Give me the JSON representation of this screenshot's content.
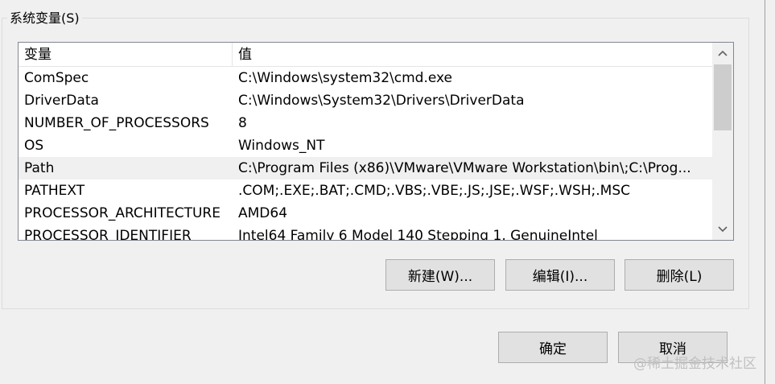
{
  "group": {
    "label": "系统变量(S)"
  },
  "list": {
    "headers": [
      "变量",
      "值"
    ],
    "rows": [
      {
        "name": "ComSpec",
        "value": "C:\\Windows\\system32\\cmd.exe"
      },
      {
        "name": "DriverData",
        "value": "C:\\Windows\\System32\\Drivers\\DriverData"
      },
      {
        "name": "NUMBER_OF_PROCESSORS",
        "value": "8"
      },
      {
        "name": "OS",
        "value": "Windows_NT"
      },
      {
        "name": "Path",
        "value": "C:\\Program Files (x86)\\VMware\\VMware Workstation\\bin\\;C:\\Prog..."
      },
      {
        "name": "PATHEXT",
        "value": ".COM;.EXE;.BAT;.CMD;.VBS;.VBE;.JS;.JSE;.WSF;.WSH;.MSC"
      },
      {
        "name": "PROCESSOR_ARCHITECTURE",
        "value": "AMD64"
      },
      {
        "name": "PROCESSOR_IDENTIFIER",
        "value": "Intel64 Family 6 Model 140 Stepping 1, GenuineIntel"
      }
    ],
    "selected_index": 4
  },
  "scrollbar": {
    "up_icon": "chevron-up-icon",
    "down_icon": "chevron-down-icon"
  },
  "buttons": {
    "new": "新建(W)...",
    "edit": "编辑(I)...",
    "delete": "删除(L)",
    "ok": "确定",
    "cancel": "取消"
  },
  "watermark": "@稀土掘金技术社区"
}
